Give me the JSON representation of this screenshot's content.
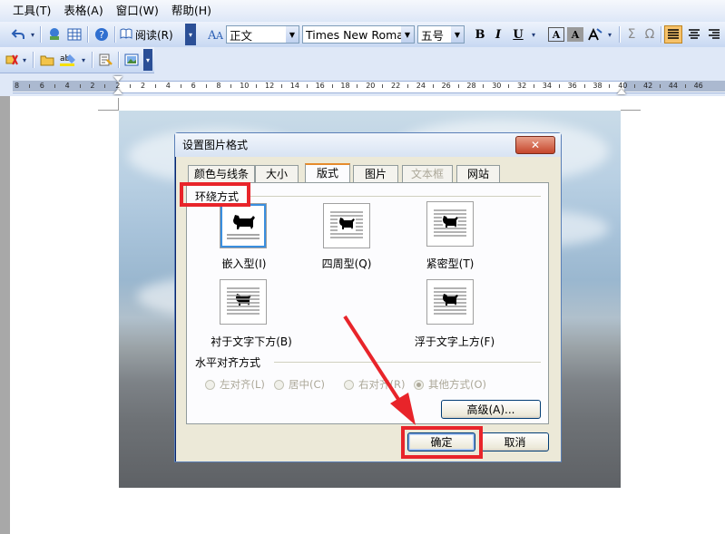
{
  "menubar": {
    "items": [
      "工具(T)",
      "表格(A)",
      "窗口(W)",
      "帮助(H)"
    ]
  },
  "toolbar": {
    "read_label": "阅读(R)",
    "style_value": "正文",
    "font_value": "Times New Roman",
    "size_value": "五号",
    "bold": "B",
    "italic": "I",
    "underline": "U",
    "char_border": "A",
    "char_shade": "A",
    "sigma": "Σ",
    "omega": "Ω",
    "accent_color": "#f6c26a"
  },
  "ruler": {
    "numbers": [
      "8",
      "6",
      "4",
      "2",
      "2",
      "2",
      "4",
      "6",
      "8",
      "10",
      "12",
      "14",
      "16",
      "18",
      "20",
      "22",
      "24",
      "26",
      "28",
      "30",
      "32",
      "34",
      "36",
      "38",
      "40",
      "42",
      "44",
      "46"
    ]
  },
  "dialog": {
    "title": "设置图片格式",
    "close_label": "✕",
    "tabs": [
      {
        "label": "颜色与线条",
        "state": "normal"
      },
      {
        "label": "大小",
        "state": "normal"
      },
      {
        "label": "版式",
        "state": "active"
      },
      {
        "label": "图片",
        "state": "normal"
      },
      {
        "label": "文本框",
        "state": "disabled"
      },
      {
        "label": "网站",
        "state": "normal"
      }
    ],
    "wrap_group_label": "环绕方式",
    "wrap_options": [
      {
        "label": "嵌入型(I)",
        "selected": true
      },
      {
        "label": "四周型(Q)",
        "selected": false
      },
      {
        "label": "紧密型(T)",
        "selected": false
      },
      {
        "label": "衬于文字下方(B)",
        "selected": false
      },
      {
        "label": "浮于文字上方(F)",
        "selected": false
      }
    ],
    "align_group_label": "水平对齐方式",
    "align_options": [
      {
        "label": "左对齐(L)",
        "checked": false
      },
      {
        "label": "居中(C)",
        "checked": false
      },
      {
        "label": "右对齐(R)",
        "checked": false
      },
      {
        "label": "其他方式(O)",
        "checked": true
      }
    ],
    "advanced_label": "高级(A)...",
    "ok_label": "确定",
    "cancel_label": "取消"
  },
  "annotation_color": "#e8242a"
}
